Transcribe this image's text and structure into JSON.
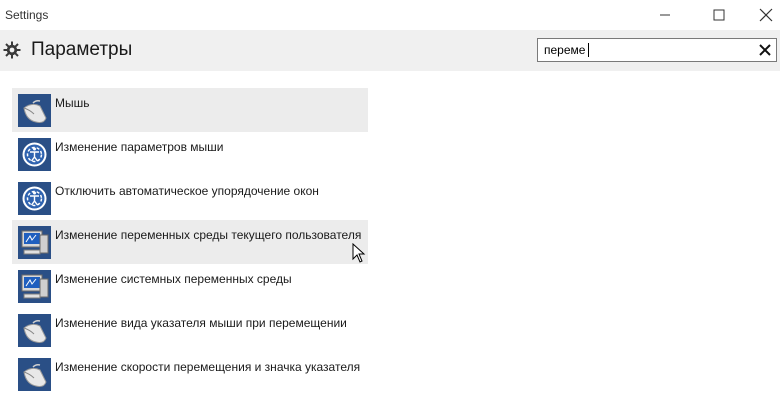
{
  "window": {
    "title": "Settings",
    "controls": [
      "minimize",
      "maximize",
      "close"
    ]
  },
  "header": {
    "icon": "gear-icon",
    "title": "Параметры"
  },
  "search": {
    "value": "переме",
    "clear_icon": "close-icon"
  },
  "results": [
    {
      "label": "Мышь",
      "icon": "mouse-icon",
      "highlighted": true
    },
    {
      "label": "Изменение параметров мыши",
      "icon": "ease-of-access-icon",
      "highlighted": false
    },
    {
      "label": "Отключить автоматическое упорядочение окон",
      "icon": "ease-of-access-icon",
      "highlighted": false
    },
    {
      "label": "Изменение переменных среды текущего пользователя",
      "icon": "system-icon",
      "highlighted": true
    },
    {
      "label": "Изменение системных переменных среды",
      "icon": "system-icon",
      "highlighted": false
    },
    {
      "label": "Изменение вида указателя мыши при перемещении",
      "icon": "mouse-icon",
      "highlighted": false
    },
    {
      "label": "Изменение скорости перемещения и значка указателя",
      "icon": "mouse-icon",
      "highlighted": false
    }
  ],
  "colors": {
    "header_bg": "#f0f0f0",
    "highlight_bg": "#ececec",
    "icon_blue": "#2a4f86"
  }
}
